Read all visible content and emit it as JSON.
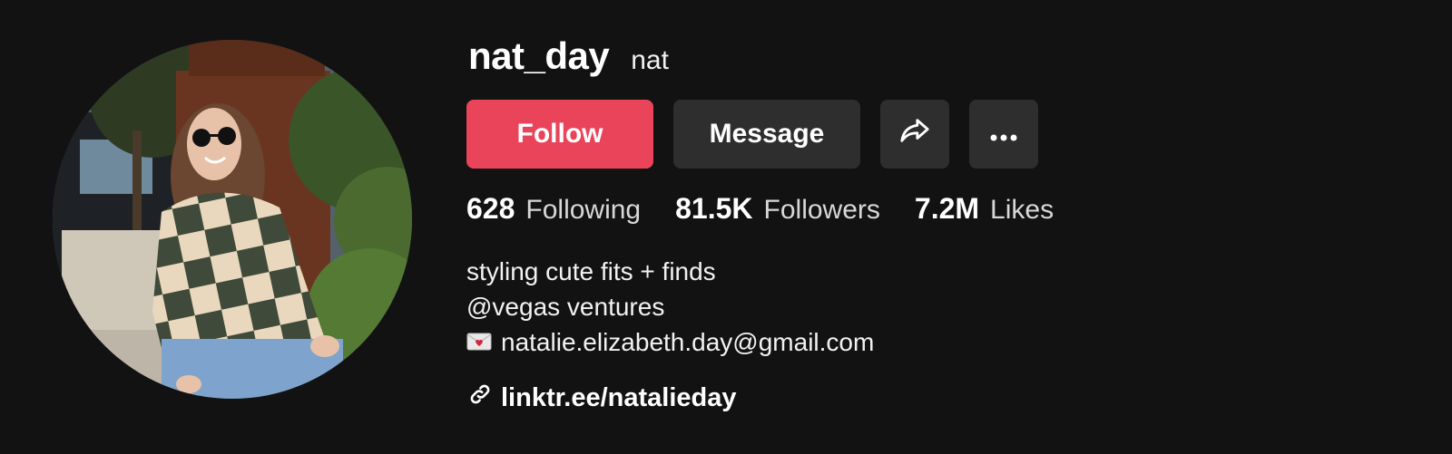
{
  "profile": {
    "username": "nat_day",
    "nickname": "nat",
    "avatar_alt": "profile photo"
  },
  "actions": {
    "follow_label": "Follow",
    "message_label": "Message",
    "share_icon": "share-arrow-icon",
    "more_icon": "more-dots-icon"
  },
  "stats": [
    {
      "value": "628",
      "label": "Following"
    },
    {
      "value": "81.5K",
      "label": "Followers"
    },
    {
      "value": "7.2M",
      "label": "Likes"
    }
  ],
  "bio": {
    "lines": [
      "styling cute fits + finds",
      "@vegas ventures"
    ],
    "email": "natalie.elizabeth.day@gmail.com",
    "email_icon": "love-letter-envelope-icon"
  },
  "link": {
    "text": "linktr.ee/natalieday",
    "icon": "link-chain-icon"
  },
  "colors": {
    "background": "#121212",
    "follow_button": "#ea445a",
    "secondary_button": "#2e2e2e"
  }
}
